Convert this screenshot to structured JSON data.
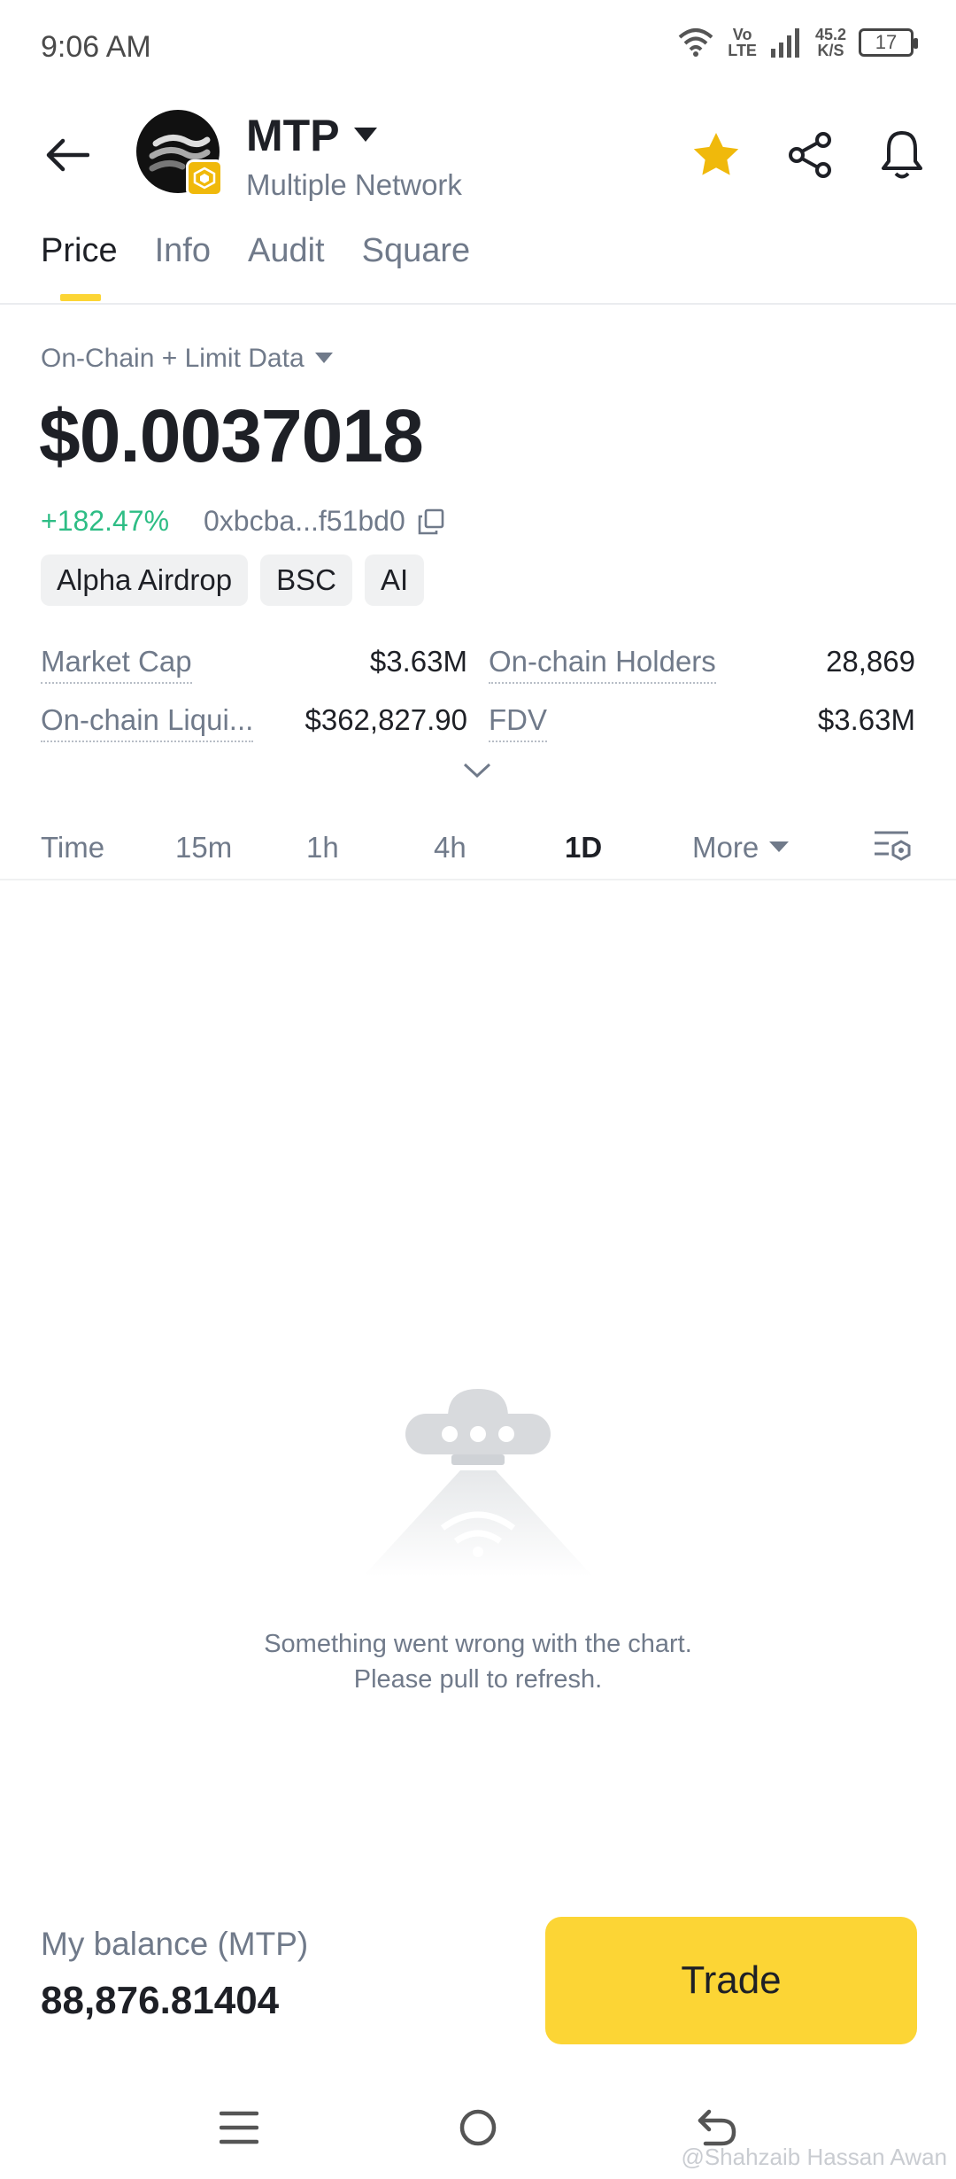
{
  "status_bar": {
    "time": "9:06 AM",
    "network_top": "Vo",
    "network_bottom": "LTE",
    "speed_value": "45.2",
    "speed_unit": "K/S",
    "battery": "17"
  },
  "header": {
    "token_symbol": "MTP",
    "network": "Multiple Network",
    "favorite_color": "#f0b90b"
  },
  "tabs": [
    {
      "label": "Price",
      "active": true
    },
    {
      "label": "Info",
      "active": false
    },
    {
      "label": "Audit",
      "active": false
    },
    {
      "label": "Square",
      "active": false
    }
  ],
  "price_section": {
    "data_source": "On-Chain + Limit Data",
    "price": "$0.0037018",
    "change": "+182.47%",
    "change_color": "#2ebd85",
    "contract_address": "0xbcba...f51bd0",
    "tags": [
      "Alpha Airdrop",
      "BSC",
      "AI"
    ]
  },
  "stats": {
    "market_cap_label": "Market Cap",
    "market_cap_value": "$3.63M",
    "holders_label": "On-chain Holders",
    "holders_value": "28,869",
    "liquidity_label": "On-chain Liqui...",
    "liquidity_value": "$362,827.90",
    "fdv_label": "FDV",
    "fdv_value": "$3.63M"
  },
  "intervals": {
    "time": "Time",
    "m15": "15m",
    "h1": "1h",
    "h4": "4h",
    "d1": "1D",
    "more": "More",
    "selected": "1D"
  },
  "chart": {
    "error_line1": "Something went wrong with the chart.",
    "error_line2": "Please pull to refresh."
  },
  "bottom": {
    "balance_label": "My balance (MTP)",
    "balance_value": "88,876.81404",
    "trade_label": "Trade",
    "accent_color": "#fcd535"
  },
  "watermark": "@Shahzaib Hassan Awan"
}
